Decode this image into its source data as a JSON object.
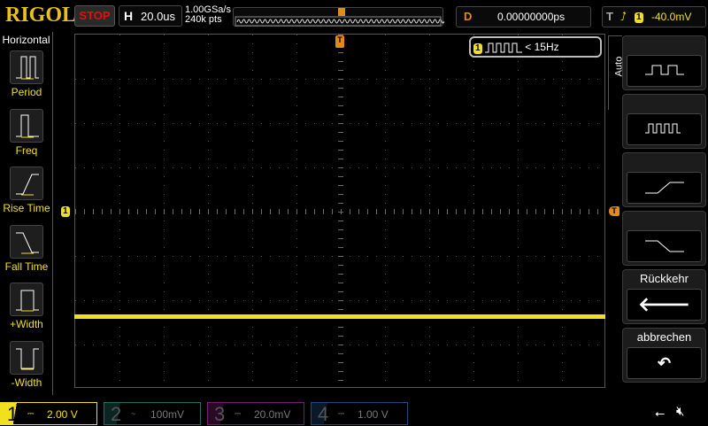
{
  "header": {
    "logo": "RIGOL",
    "run_state": "STOP",
    "horizontal_key": "H",
    "timebase": "20.0us",
    "sample_rate": "1.00GSa/s",
    "memory_depth": "240k pts",
    "delay_key": "D",
    "delay": "0.00000000ps",
    "trigger_key": "T",
    "trigger_channel": "1",
    "trigger_level": "-40.0mV",
    "trigger_slope_icon": "rising-edge-icon"
  },
  "measure_readout": {
    "channel": "1",
    "text": "< 15Hz"
  },
  "left_menu": {
    "title": "Horizontal",
    "items": [
      {
        "label": "Period"
      },
      {
        "label": "Freq"
      },
      {
        "label": "Rise Time"
      },
      {
        "label": "Fall Time"
      },
      {
        "label": "+Width"
      },
      {
        "label": "-Width"
      }
    ]
  },
  "right_menu": {
    "mode": "Auto",
    "buttons": [
      {
        "label": "",
        "icon": "slow-square-wave-icon"
      },
      {
        "label": "",
        "icon": "fast-square-wave-icon"
      },
      {
        "label": "",
        "icon": "rising-edge-icon"
      },
      {
        "label": "",
        "icon": "falling-edge-icon"
      },
      {
        "label": "Rückkehr",
        "icon": "back-arrow-icon"
      },
      {
        "label": "abbrechen",
        "icon": "undo-icon"
      }
    ]
  },
  "markers": {
    "channel1": "1",
    "trigger": "T"
  },
  "channels": [
    {
      "num": "1",
      "coupling": "⎓",
      "scale": "2.00 V",
      "color": "#f0e020",
      "active": true
    },
    {
      "num": "2",
      "coupling": "~",
      "scale": "100mV",
      "color": "#1f6e66"
    },
    {
      "num": "3",
      "coupling": "⎓",
      "scale": "20.0mV",
      "color": "#7a1f6e"
    },
    {
      "num": "4",
      "coupling": "⎓",
      "scale": "1.00 V",
      "color": "#1f4a7a"
    }
  ],
  "colors": {
    "ch1": "#f0e020",
    "trigger": "#e08a20",
    "stop": "#e01010"
  }
}
